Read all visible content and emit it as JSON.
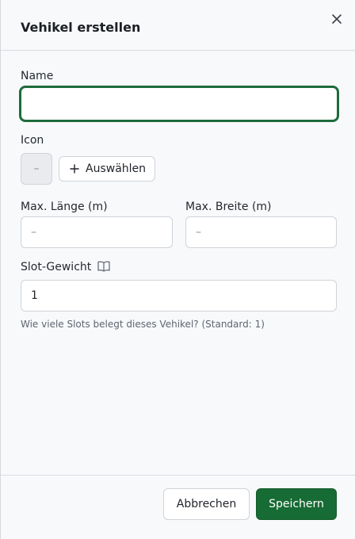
{
  "dialog": {
    "title": "Vehikel erstellen",
    "close_icon": "close-icon"
  },
  "form": {
    "name": {
      "label": "Name",
      "value": ""
    },
    "icon": {
      "label": "Icon",
      "preview": "–",
      "choose_label": "Auswählen",
      "choose_icon": "plus-icon"
    },
    "max_length": {
      "label": "Max. Länge (m)",
      "placeholder": "–",
      "value": ""
    },
    "max_width": {
      "label": "Max. Breite (m)",
      "placeholder": "–",
      "value": ""
    },
    "slot_weight": {
      "label": "Slot-Gewicht",
      "info_icon": "book-icon",
      "value": "1",
      "help": "Wie viele Slots belegt dieses Vehikel? (Standard: 1)"
    }
  },
  "footer": {
    "cancel_label": "Abbrechen",
    "save_label": "Speichern"
  },
  "colors": {
    "primary": "#176b34",
    "focus_ring": "#1e6b3c",
    "background": "#f8f9fb"
  }
}
